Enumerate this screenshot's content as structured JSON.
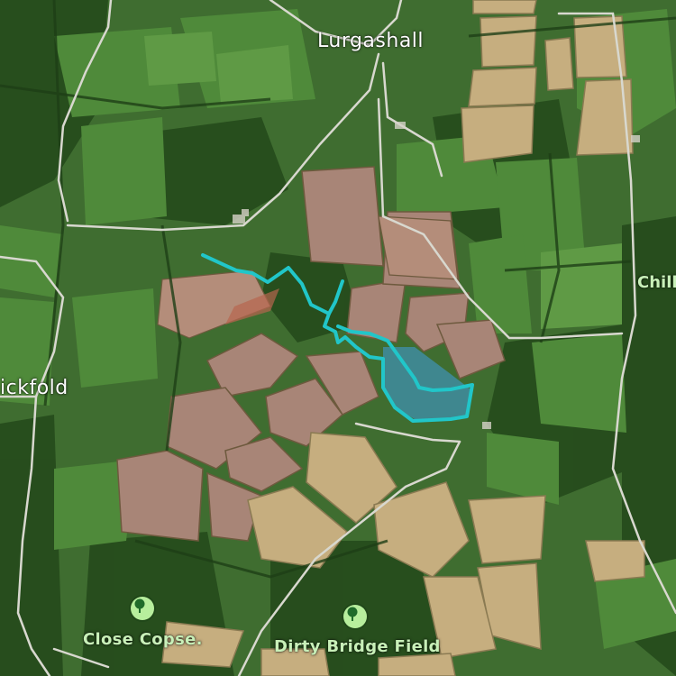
{
  "map": {
    "places": {
      "lurgashall": "Lurgashall",
      "fickfold": "ickfold",
      "chill": "Chill"
    },
    "pois": {
      "close_copse": "Close Copse.",
      "dirty_bridge_field": "Dirty Bridge Field"
    },
    "icons": {
      "poi": "tree-icon"
    },
    "colors": {
      "route": "#21c6c9",
      "water": "#3f8a9a",
      "poi_badge": "#b7ee9d",
      "label": "#ffffff"
    }
  }
}
